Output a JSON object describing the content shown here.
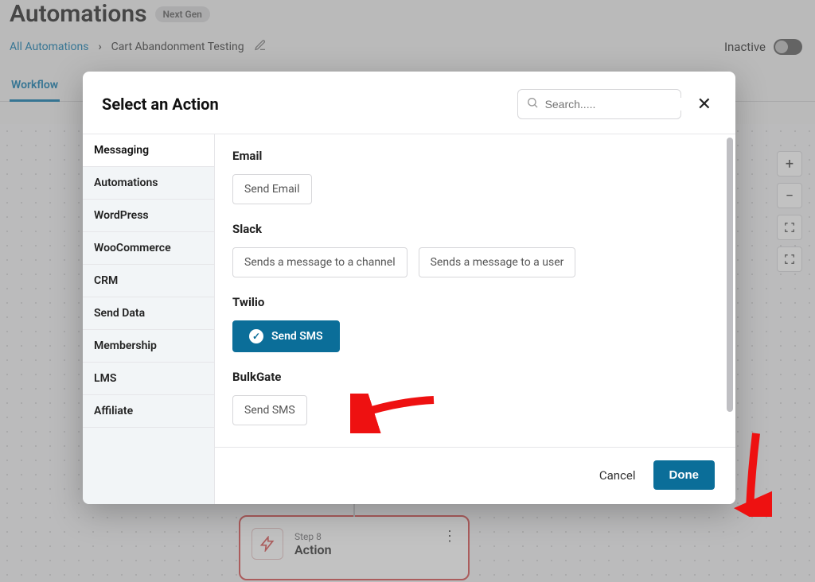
{
  "page": {
    "title": "Automations",
    "badge": "Next Gen",
    "breadcrumb": {
      "root": "All Automations",
      "current": "Cart Abandonment Testing"
    },
    "status_label": "Inactive",
    "tabs": {
      "workflow": "Workflow"
    },
    "step": {
      "num": "Step 8",
      "title": "Action"
    }
  },
  "zoom": {
    "in": "+",
    "out": "−"
  },
  "modal": {
    "title": "Select an Action",
    "search_placeholder": "Search.....",
    "categories": {
      "0": "Messaging",
      "1": "Automations",
      "2": "WordPress",
      "3": "WooCommerce",
      "4": "CRM",
      "5": "Send Data",
      "6": "Membership",
      "7": "LMS",
      "8": "Affiliate"
    },
    "sections": {
      "email": {
        "title": "Email",
        "chips": {
          "0": "Send Email"
        }
      },
      "slack": {
        "title": "Slack",
        "chips": {
          "0": "Sends a message to a channel",
          "1": "Sends a message to a user"
        }
      },
      "twilio": {
        "title": "Twilio",
        "chips": {
          "0": "Send SMS"
        }
      },
      "bulkgate": {
        "title": "BulkGate",
        "chips": {
          "0": "Send SMS"
        }
      }
    },
    "footer": {
      "cancel": "Cancel",
      "done": "Done"
    }
  }
}
